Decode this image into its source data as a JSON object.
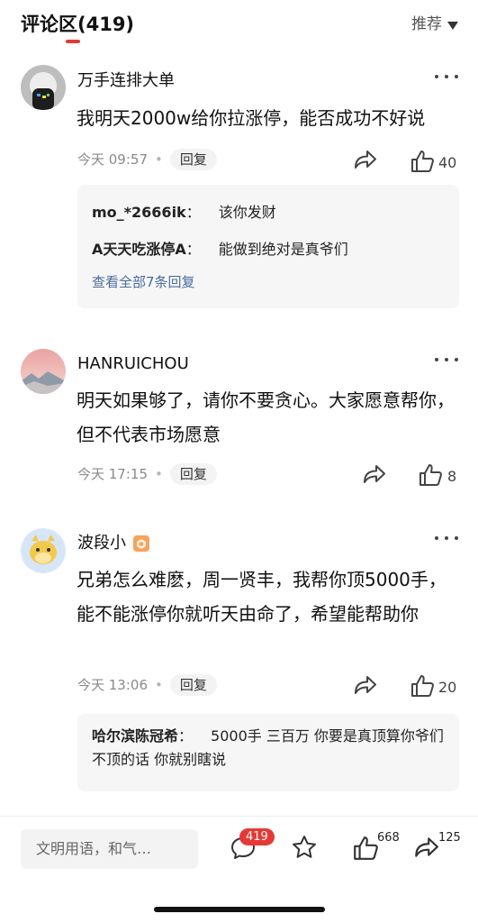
{
  "header": {
    "title": "评论区(419)",
    "sort_label": "推荐"
  },
  "comments": [
    {
      "author": "万手连排大单",
      "content": "我明天2000w给你拉涨停，能否成功不好说",
      "time": "今天 09:57",
      "reply_label": "回复",
      "likes": "40",
      "replies": [
        {
          "name": "mo_*2666ik",
          "sep": "：",
          "text": "该你发财"
        },
        {
          "name": "A天天吃涨停A",
          "sep": "：",
          "text": "能做到绝对是真爷们"
        }
      ],
      "view_all": "查看全部7条回复"
    },
    {
      "author": "HANRUICHOU",
      "content": "明天如果够了，请你不要贪心。大家愿意帮你，但不代表市场愿意",
      "time": "今天 17:15",
      "reply_label": "回复",
      "likes": "8"
    },
    {
      "author": "波段小",
      "content": "兄弟怎么难麽，周一贤丰，我帮你顶5000手，能不能涨停你就听天由命了，希望能帮助你",
      "time": "今天 13:06",
      "reply_label": "回复",
      "likes": "20",
      "replies": [
        {
          "name": "哈尔滨陈冠希",
          "sep": "：",
          "text": "5000手 三百万 你要是真顶算你爷们 不顶的话 你就别瞎说"
        }
      ]
    }
  ],
  "bottom_bar": {
    "input_placeholder": "文明用语，和气…",
    "comment_count": "419",
    "like_count": "668",
    "share_count": "125"
  },
  "colors": {
    "accent": "#e53935",
    "link": "#4a6c9a",
    "muted": "#8a8a8a"
  },
  "icons": [
    "chevron-down-icon",
    "more-icon",
    "share-icon",
    "thumbs-up-icon",
    "comment-icon",
    "star-icon"
  ]
}
